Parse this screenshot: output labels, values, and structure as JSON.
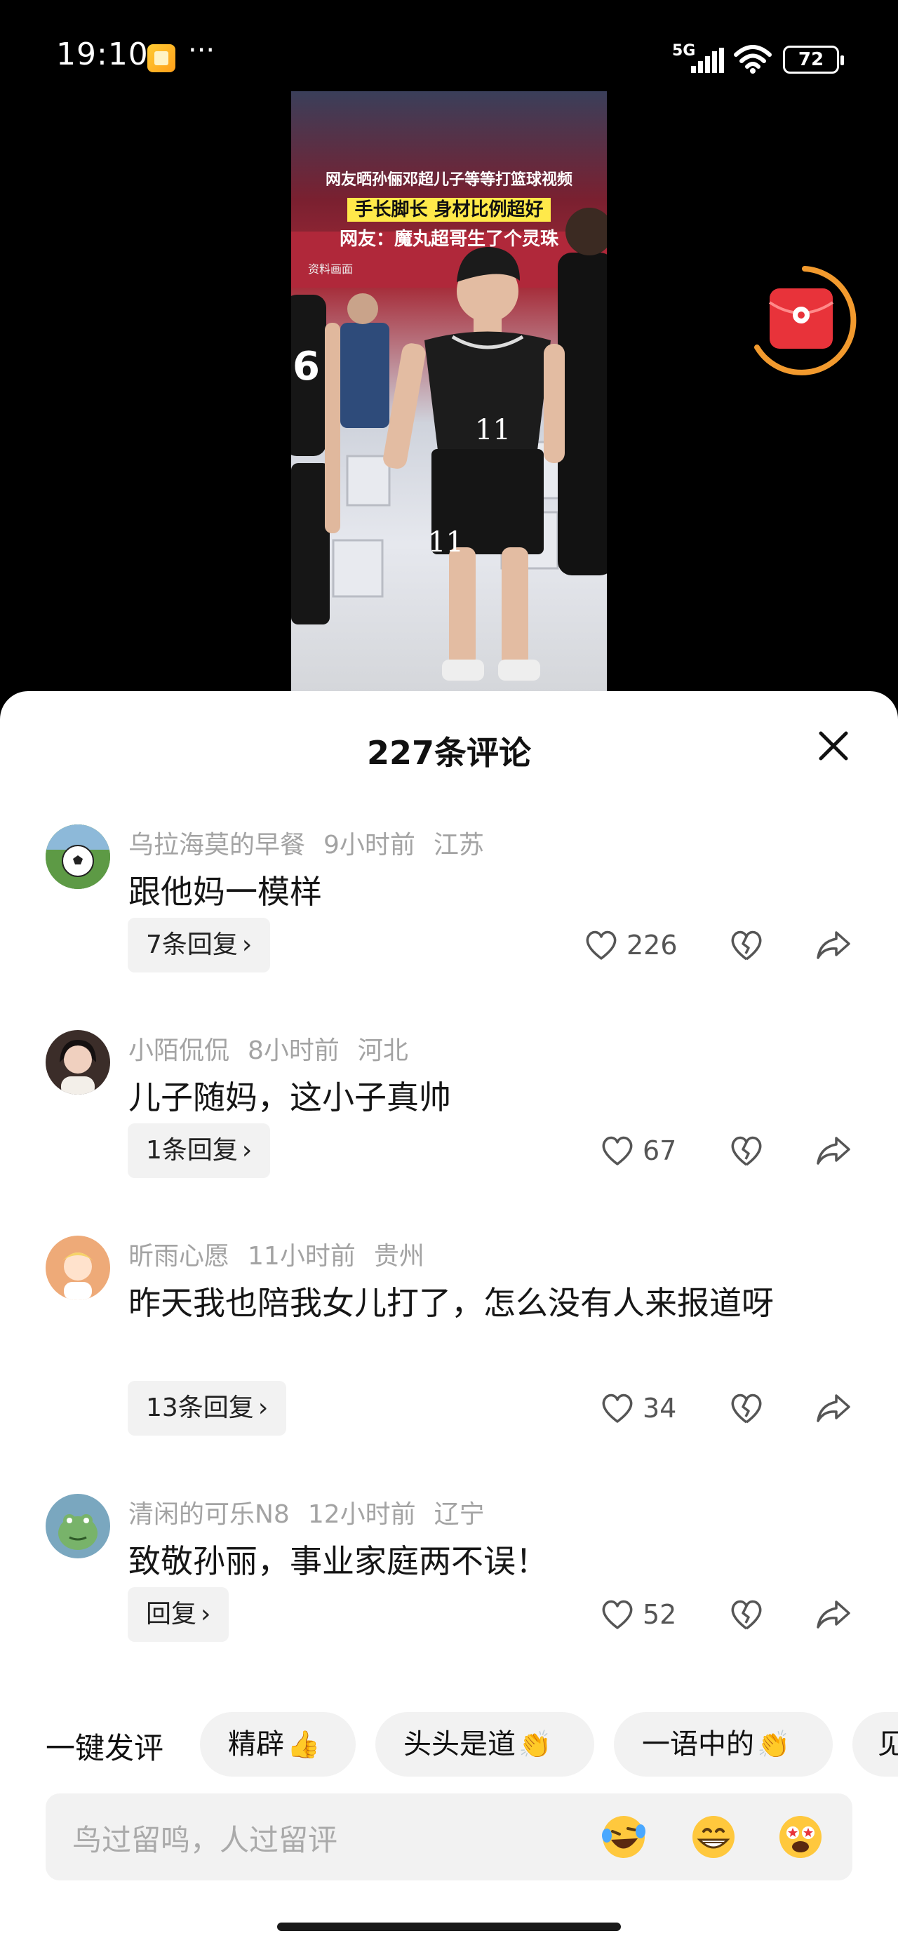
{
  "status_bar": {
    "time": "19:10",
    "more": "···",
    "network": "5G",
    "battery": "72"
  },
  "video": {
    "caption_line1": "网友晒孙俪邓超儿子等等打篮球视频",
    "caption_line2": "手长脚长 身材比例超好",
    "caption_line3": "网友：魔丸超哥生了个灵珠",
    "source_tag": "资料画面",
    "jersey_center": "11",
    "jersey_left": "6"
  },
  "comments_sheet": {
    "title": "227条评论",
    "comments": [
      {
        "user": "乌拉海莫的早餐",
        "time": "9小时前",
        "location": "江苏",
        "text": "跟他妈一模样",
        "replies": "7条回复",
        "likes": "226",
        "avatar_color": "#3f7a2f"
      },
      {
        "user": "小陌侃侃",
        "time": "8小时前",
        "location": "河北",
        "text": "儿子随妈，这小子真帅",
        "replies": "1条回复",
        "likes": "67",
        "avatar_color": "#2b2220"
      },
      {
        "user": "昕雨心愿",
        "time": "11小时前",
        "location": "贵州",
        "text": "昨天我也陪我女儿打了，怎么没有人来报道呀",
        "replies": "13条回复",
        "likes": "34",
        "avatar_color": "#e9a67a"
      },
      {
        "user": "清闲的可乐N8",
        "time": "12小时前",
        "location": "辽宁",
        "text": "致敬孙丽，事业家庭两不误！",
        "replies": "回复",
        "likes": "52",
        "avatar_color": "#6f9fb8"
      }
    ],
    "chevron": "›"
  },
  "quick_reply": {
    "label": "一键发评",
    "chips": [
      {
        "text": "精辟",
        "emoji": "👍"
      },
      {
        "text": "头头是道",
        "emoji": "👏"
      },
      {
        "text": "一语中的",
        "emoji": "👏"
      },
      {
        "text": "见",
        "emoji": ""
      }
    ]
  },
  "input": {
    "placeholder": "鸟过留鸣，人过留评",
    "emojis": [
      "laugh-cry-emoji",
      "grin-emoji",
      "star-eyes-emoji"
    ]
  },
  "colors": {
    "accent_orange": "#f29a2e",
    "red_packet": "#e8333a",
    "meta_gray": "#a3a3a3"
  }
}
